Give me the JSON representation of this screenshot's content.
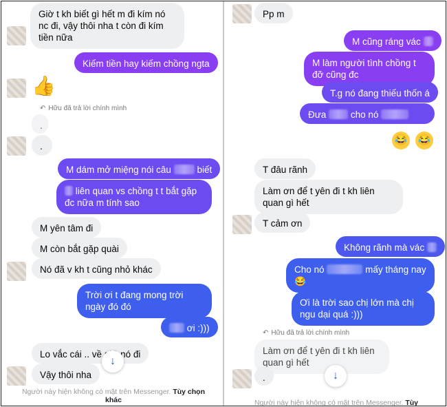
{
  "left": {
    "messages": [
      {
        "text": "Giờ t kh biết gì hết m đi kím nó nc đi, vậy thôi nha t còn đi kím tiền nữa"
      },
      {
        "text": "Kiếm tiền hay kiếm chồng ngta"
      },
      {
        "text": "."
      },
      {
        "text_a": "M dám mở miệng nói câu",
        "text_b": "biết"
      },
      {
        "text_a": "liên quan vs chồng t t bắt gặp đc nữa m tính sao"
      },
      {
        "text": "M yên tâm đi"
      },
      {
        "text": "M còn bắt gặp quài"
      },
      {
        "text": "Nó đã v kh t cũng nhỏ khác"
      },
      {
        "text": "Trời ơi t đang mong trời ngày đó đó"
      },
      {
        "text": "ơi :)))"
      },
      {
        "text": "Lo vắc cái .. về giữ nó đi"
      },
      {
        "text": "Vậy thôi nha"
      }
    ],
    "reply_note": "Hữu đã trả lời chính mình",
    "reply_quote": ".",
    "thumb_icon": "thumbs-up-icon",
    "footer_text": "Người này hiện không có mặt trên Messenger.",
    "footer_link": "Tùy chọn khác"
  },
  "right": {
    "messages": [
      {
        "text": "Pp m"
      },
      {
        "text": "M cũng ráng vác"
      },
      {
        "text": "M làm người tình chồng t đỡ cũng đc"
      },
      {
        "text": "T.g nó đang thiếu thốn á"
      },
      {
        "text_a": "Đưa",
        "text_b": "cho nó"
      },
      {
        "text": "T đâu rãnh"
      },
      {
        "text": "Làm ơn để t yên đi t kh liên quan gì hết"
      },
      {
        "text": "T cảm ơn"
      },
      {
        "text": "Không rãnh mà vác"
      },
      {
        "text_a": "Cho nó",
        "text_b": "mấy tháng nay"
      },
      {
        "text": "Ơi là trời sao chị lớn mà chị ngu dại quá :)))"
      }
    ],
    "emojis": [
      "😂",
      "😂"
    ],
    "reply_note": "Hữu đã trả lời chính mình",
    "reply_quote": "Làm ơn để t yên đi t kh liên quan gì hết",
    "reply_dot": ".",
    "footer_text": "Người này hiện không có mặt trên Messenger.",
    "footer_link": "Tùy"
  },
  "colors": {
    "incoming_bubble": "#eeeff1",
    "outgoing_purple": "#8a3ef2",
    "outgoing_blue": "#3e5fee",
    "scroll_arrow": "#1a5fd6"
  },
  "icons": {
    "scroll_down": "arrow-down-icon",
    "reply": "reply-arrow-icon",
    "emoji": "laughing-tears-icon"
  }
}
